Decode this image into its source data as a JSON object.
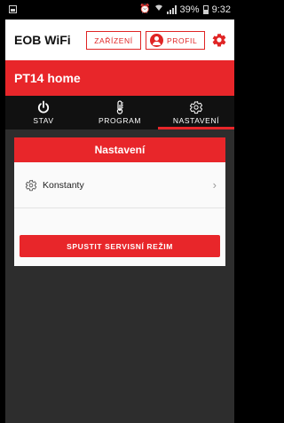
{
  "statusbar": {
    "battery": "39%",
    "time": "9:32"
  },
  "header": {
    "title": "EOB WiFi",
    "devices_label": "ZAŘÍZENÍ",
    "profile_label": "PROFIL"
  },
  "device": {
    "name": "PT14 home"
  },
  "tabs": [
    {
      "label": "STAV",
      "icon": "power-icon"
    },
    {
      "label": "PROGRAM",
      "icon": "thermometer-icon"
    },
    {
      "label": "NASTAVENÍ",
      "icon": "gear-icon",
      "active": true
    }
  ],
  "settings": {
    "title": "Nastavení",
    "rows": [
      {
        "label": "Konstanty",
        "icon": "gear-icon"
      }
    ],
    "service_button": "SPUSTIT SERVISNÍ REŽIM"
  },
  "colors": {
    "accent": "#e8262a",
    "background": "#2d2d2d",
    "tabbar": "#111111"
  }
}
